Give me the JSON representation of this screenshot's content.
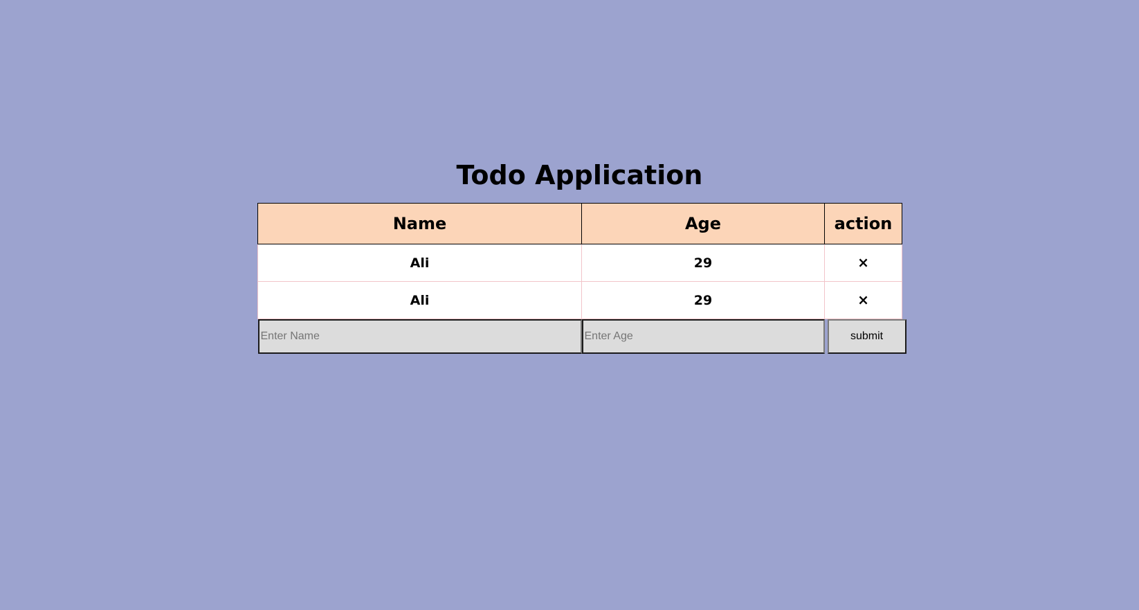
{
  "app": {
    "title": "Todo Application"
  },
  "table": {
    "headers": {
      "name": "Name",
      "age": "Age",
      "action": "action"
    },
    "rows": [
      {
        "name": "Ali",
        "age": "29",
        "delete_label": "×"
      },
      {
        "name": "Ali",
        "age": "29",
        "delete_label": "×"
      }
    ]
  },
  "form": {
    "name_placeholder": "Enter Name",
    "name_value": "",
    "age_placeholder": "Enter Age",
    "age_value": "",
    "submit_label": "submit"
  },
  "colors": {
    "page_background": "#9ca3cf",
    "header_background": "#fcd5b8",
    "row_background": "#ffffff",
    "row_border": "#f2c4c9",
    "input_background": "#dcdcdc"
  }
}
